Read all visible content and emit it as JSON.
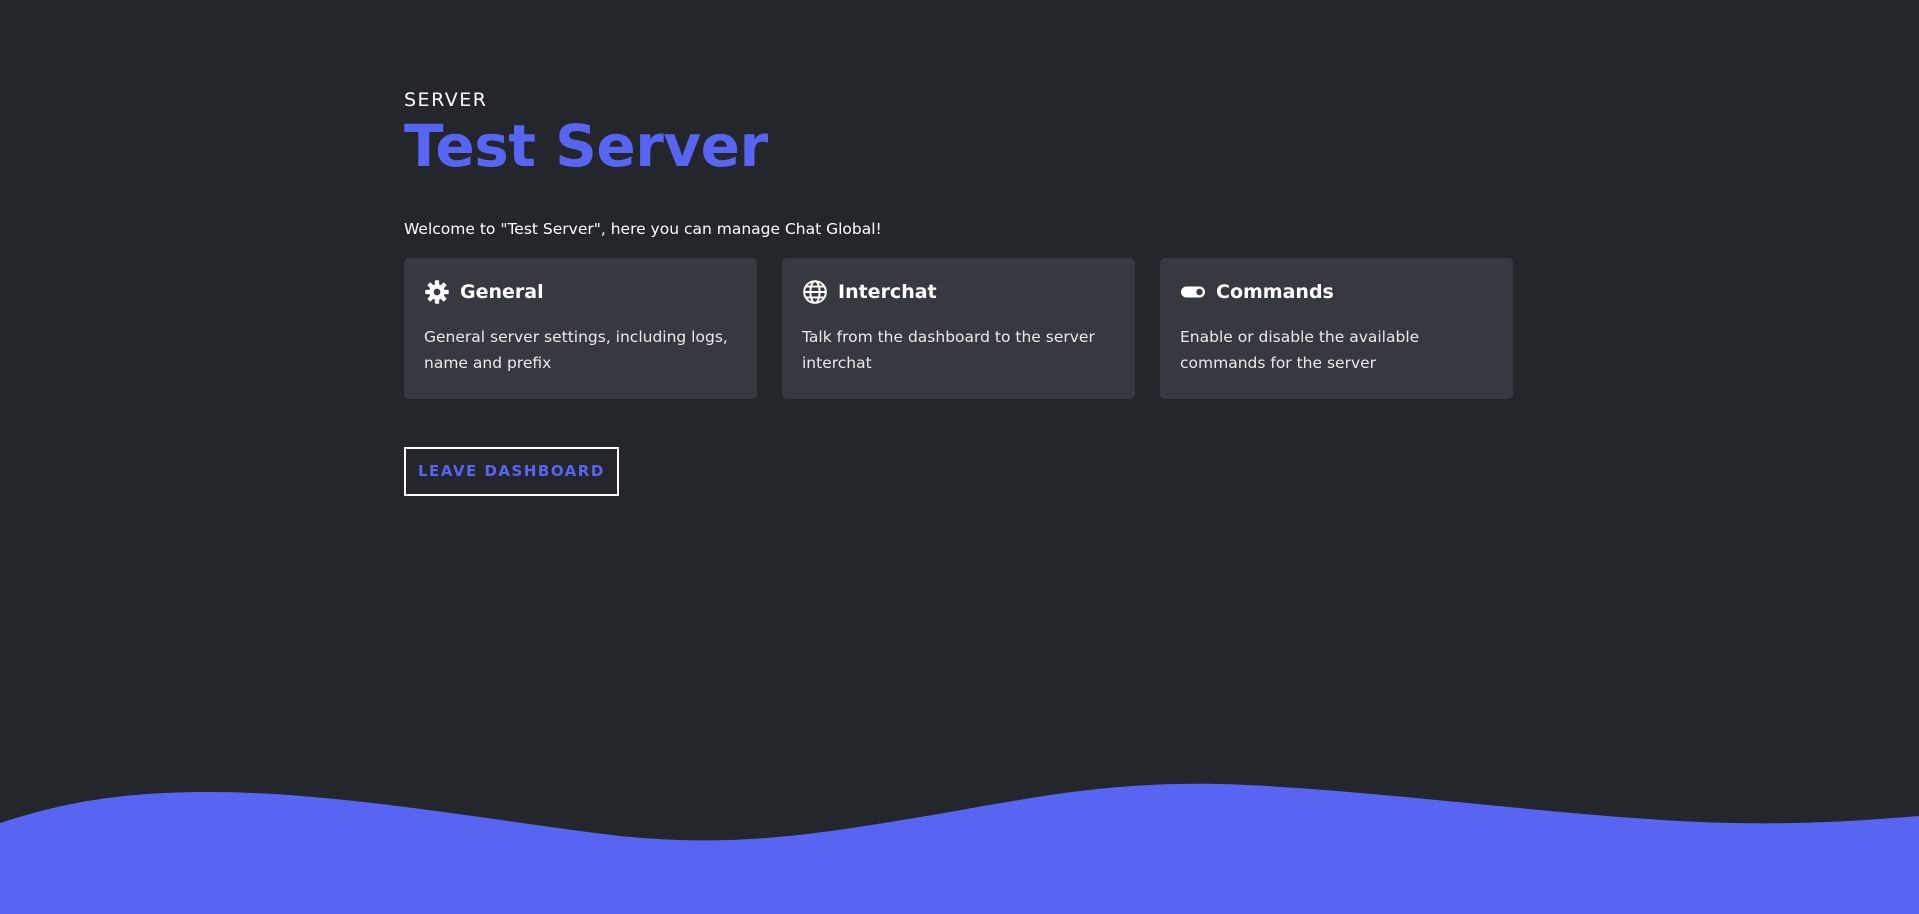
{
  "colors": {
    "background": "#23262b",
    "accent": "#5865f2",
    "card": "#363940",
    "text": "#ffffff"
  },
  "header": {
    "eyebrow": "SERVER",
    "title": "Test Server"
  },
  "welcome_text": "Welcome to \"Test Server\", here you can manage Chat Global!",
  "cards": [
    {
      "icon": "gear-icon",
      "title": "General",
      "description": "General server settings, including logs, name and prefix"
    },
    {
      "icon": "globe-icon",
      "title": "Interchat",
      "description": "Talk from the dashboard to the server interchat"
    },
    {
      "icon": "toggle-icon",
      "title": "Commands",
      "description": "Enable or disable the available commands for the server"
    }
  ],
  "leave_button": {
    "label": "LEAVE DASHBOARD"
  }
}
